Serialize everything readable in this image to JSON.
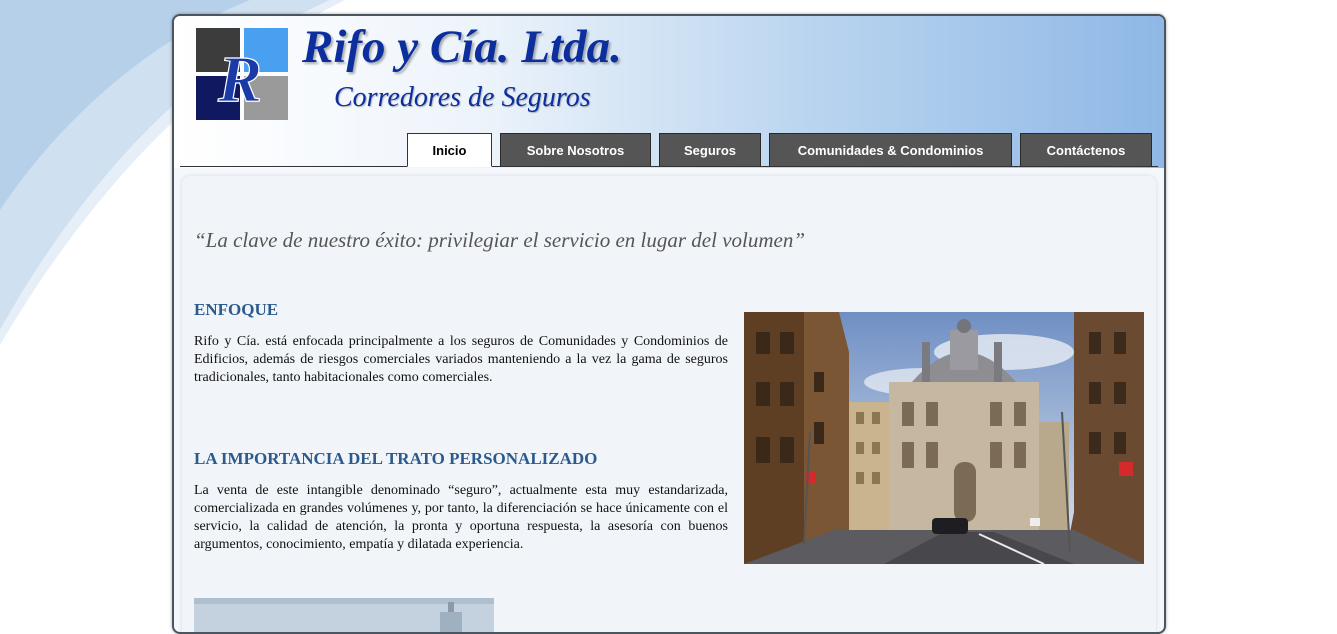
{
  "colors": {
    "brand_blue": "#0d2f9e",
    "heading_blue": "#2b5a8c",
    "tab_gray": "#555555",
    "quote_gray": "#555555"
  },
  "logo": {
    "letter": "R",
    "title": "Rifo y Cía. Ltda.",
    "subtitle": "Corredores de Seguros"
  },
  "nav": {
    "active": "Inicio",
    "tabs": [
      "Inicio",
      "Sobre Nosotros",
      "Seguros",
      "Comunidades & Condominios",
      "Contáctenos"
    ]
  },
  "main": {
    "quote": "“La clave de nuestro éxito: privilegiar el servicio en lugar del volumen”",
    "sections": [
      {
        "heading": "ENFOQUE",
        "body": "Rifo y Cía. está enfocada principalmente a los seguros de Comunidades y Condominios de Edificios, además de riesgos comerciales variados manteniendo a la vez la gama de seguros tradicionales, tanto habitacionales como comerciales."
      },
      {
        "heading": "LA IMPORTANCIA DEL TRATO PERSONALIZADO",
        "body": "La venta de este intangible denominado “seguro”, actualmente esta muy estandarizada, comercializada en grandes volúmenes y, por tanto, la diferenciación se hace únicamente con el servicio, la calidad de atención, la pronta y oportuna respuesta, la asesoría con buenos argumentos, conocimiento, empatía y dilatada experiencia."
      }
    ]
  }
}
